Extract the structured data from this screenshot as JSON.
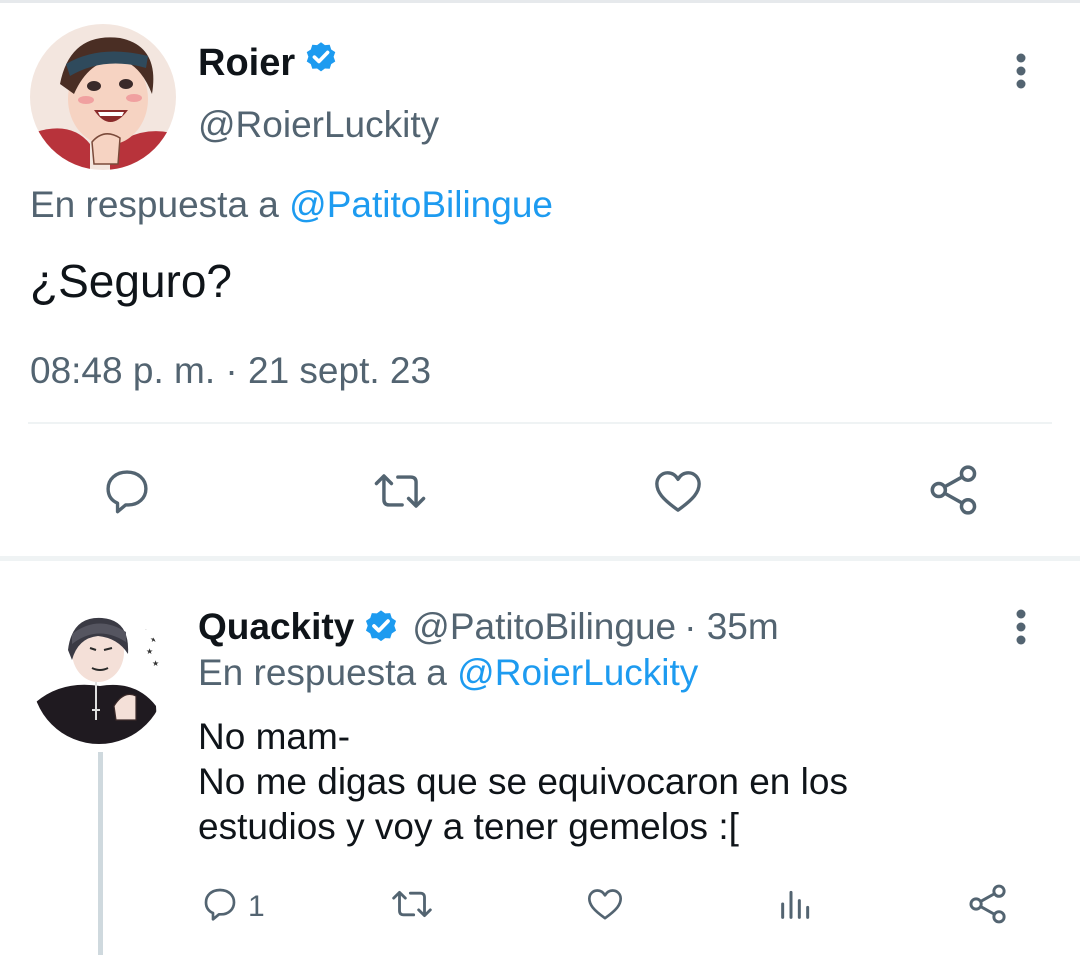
{
  "main_tweet": {
    "author_name": "Roier",
    "author_handle": "@RoierLuckity",
    "reply_prefix": "En respuesta a",
    "reply_to": "@PatitoBilingue",
    "text": "¿Seguro?",
    "timestamp": "08:48 p. m. · 21 sept. 23"
  },
  "reply_tweet": {
    "author_name": "Quackity",
    "author_handle": "@PatitoBilingue",
    "time_ago": "· 35m",
    "reply_prefix": "En respuesta a",
    "reply_to": "@RoierLuckity",
    "text_lines": [
      "No mam-",
      "No me digas que se equivocaron en los",
      "estudios y voy a tener gemelos :["
    ],
    "reply_count": "1"
  },
  "icons": [
    "verified-badge-icon",
    "more-options-icon",
    "reply-icon",
    "retweet-icon",
    "like-icon",
    "share-icon",
    "analytics-icon"
  ],
  "colors": {
    "accent": "#1d9bf0",
    "icon_gray": "#536471",
    "text": "#0f1419"
  }
}
